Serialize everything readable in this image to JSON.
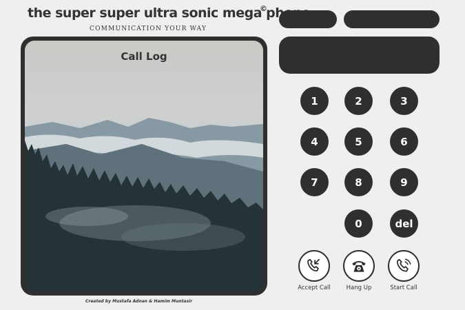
{
  "header": {
    "title": "the super super ultra sonic mega phone",
    "copyright": "©",
    "tagline": "COMMUNICATION YOUR WAY"
  },
  "screen": {
    "title": "Call Log"
  },
  "footer": {
    "credit": "Created by Mustafa Adnan & Hamim Muntasir"
  },
  "keypad": {
    "keys": [
      "1",
      "2",
      "3",
      "4",
      "5",
      "6",
      "7",
      "8",
      "9",
      "0",
      "del"
    ]
  },
  "actions": {
    "accept": {
      "label": "Accept Call",
      "icon": "phone-incoming-icon"
    },
    "hangup": {
      "label": "Hang Up",
      "icon": "rotary-phone-icon"
    },
    "start": {
      "label": "Start Call",
      "icon": "phone-ringing-icon"
    }
  },
  "colors": {
    "background": "#efefef",
    "dark": "#2f2f2f",
    "key_text": "#ffffff"
  }
}
